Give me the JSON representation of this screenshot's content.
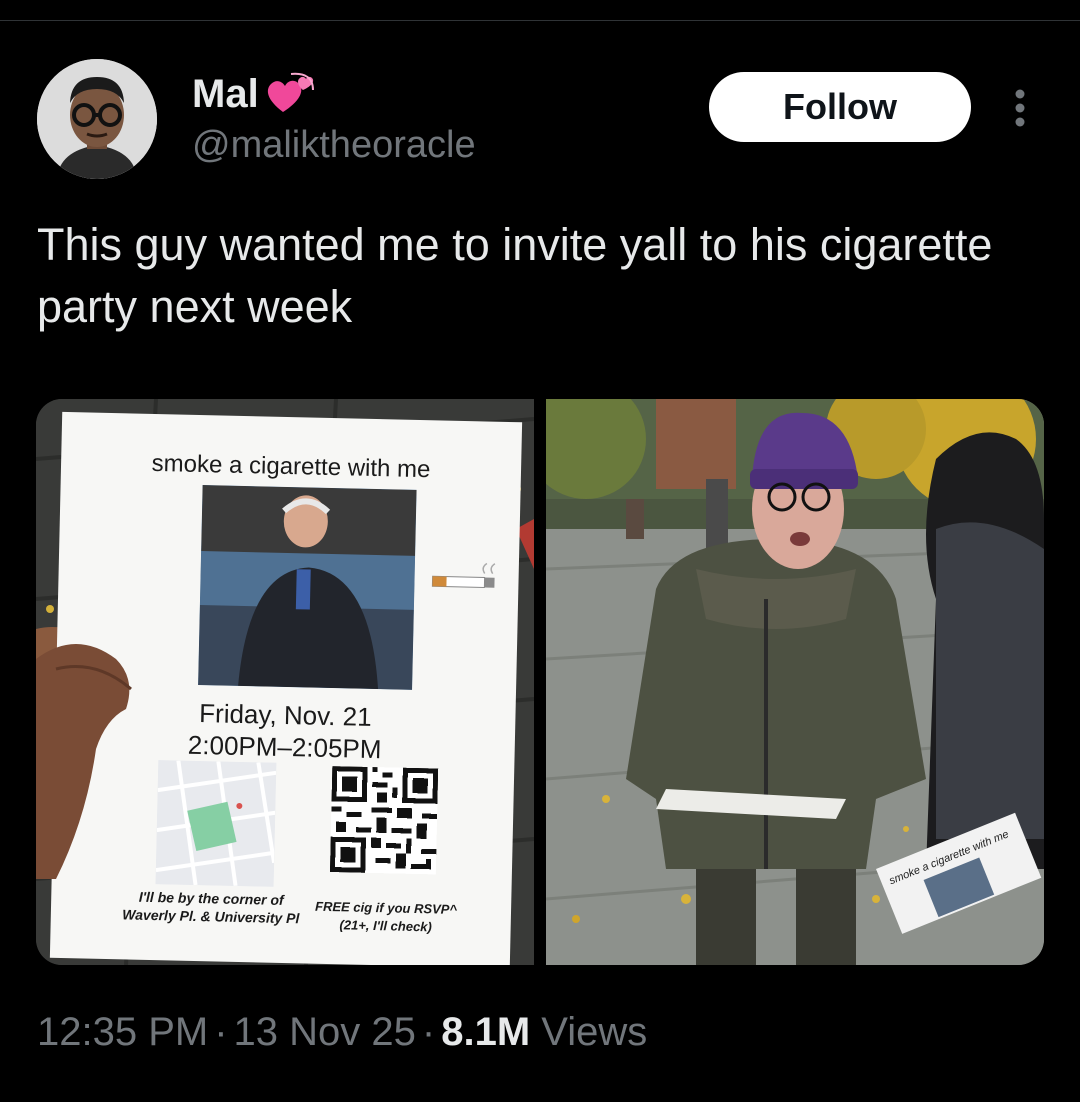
{
  "author": {
    "display_name": "Mal",
    "emoji": "revolving-hearts-emoji",
    "handle": "@maliktheoracle"
  },
  "follow_label": "Follow",
  "more_icon": "more-dots-icon",
  "tweet_text": "This guy wanted me to invite yall to his cigarette party next week",
  "flyer": {
    "title": "smoke a cigarette with me",
    "date": "Friday, Nov. 21",
    "time": "2:00PM–2:05PM",
    "location_line1": "I'll be by the corner of",
    "location_line2": "Waverly Pl. & University Pl",
    "rsvp_line1": "FREE cig if you RSVP^",
    "rsvp_line2": "(21+, I'll check)"
  },
  "mini_flyer_text": "smoke a cigarette with me",
  "meta": {
    "time": "12:35 PM",
    "date": "13 Nov 25",
    "views_count": "8.1M",
    "views_label": "Views",
    "separator": "·"
  },
  "colors": {
    "background": "#000000",
    "text": "#e7e9ea",
    "secondary": "#71767b",
    "follow_bg": "#ffffff",
    "heart": "#f0489a"
  }
}
